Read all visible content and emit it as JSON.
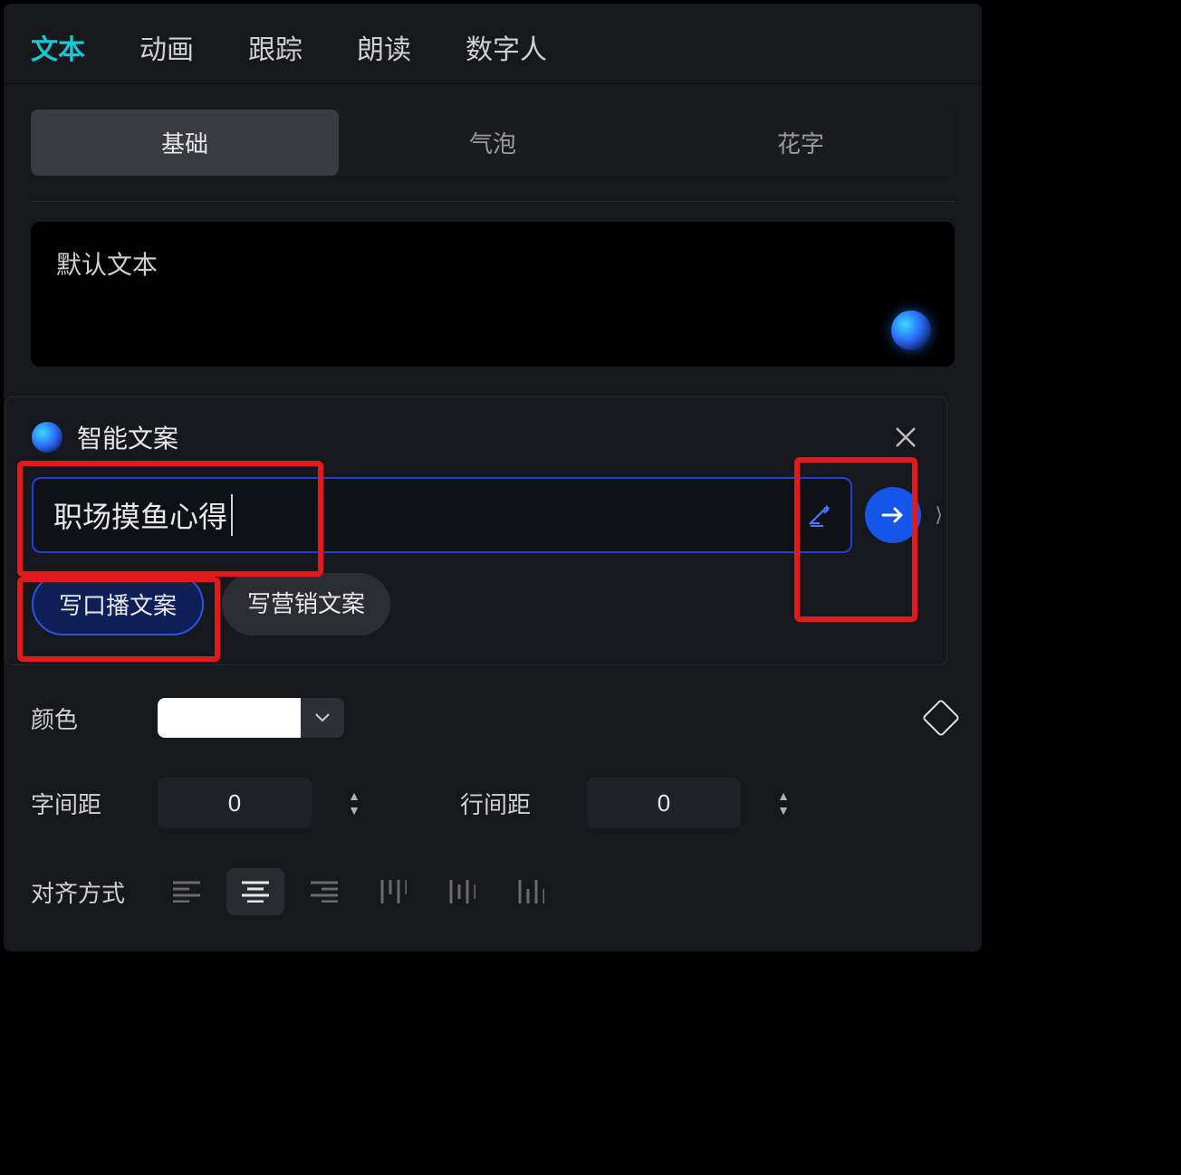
{
  "topTabs": {
    "t0": "文本",
    "t1": "动画",
    "t2": "跟踪",
    "t3": "朗读",
    "t4": "数字人"
  },
  "subTabs": {
    "s0": "基础",
    "s1": "气泡",
    "s2": "花字"
  },
  "textBox": {
    "label": "默认文本"
  },
  "popup": {
    "title": "智能文案",
    "inputValue": "职场摸鱼心得",
    "chips": {
      "c0": "写口播文案",
      "c1": "写营销文案"
    }
  },
  "controls": {
    "colorLabel": "颜色",
    "colorValue": "#FFFFFF",
    "letterSpacingLabel": "字间距",
    "letterSpacingValue": "0",
    "lineSpacingLabel": "行间距",
    "lineSpacingValue": "0",
    "alignLabel": "对齐方式"
  }
}
